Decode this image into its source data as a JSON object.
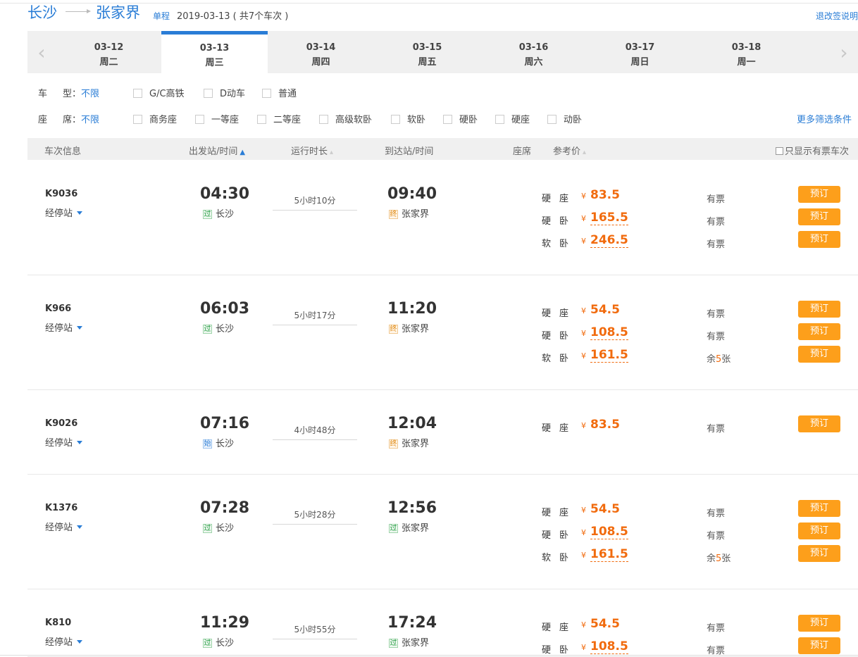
{
  "header": {
    "from_city": "长沙",
    "to_city": "张家界",
    "trip_type": "单程",
    "date_summary": "2019-03-13 ( 共7个车次 )",
    "refund_link": "退改签说明"
  },
  "date_bar": {
    "prev_icon": "chevron-left-icon",
    "next_icon": "chevron-right-icon",
    "dates": [
      {
        "date": "03-12",
        "weekday": "周二"
      },
      {
        "date": "03-13",
        "weekday": "周三"
      },
      {
        "date": "03-14",
        "weekday": "周四"
      },
      {
        "date": "03-15",
        "weekday": "周五"
      },
      {
        "date": "03-16",
        "weekday": "周六"
      },
      {
        "date": "03-17",
        "weekday": "周日"
      },
      {
        "date": "03-18",
        "weekday": "周一"
      }
    ],
    "active_index": 1
  },
  "filters": {
    "train_type": {
      "label_a": "车",
      "label_b": "型：",
      "all": "不限",
      "options": [
        "G/C高铁",
        "D动车",
        "普通"
      ]
    },
    "seat": {
      "label_a": "座",
      "label_b": "席：",
      "all": "不限",
      "options": [
        "商务座",
        "一等座",
        "二等座",
        "高级软卧",
        "软卧",
        "硬卧",
        "硬座",
        "动卧"
      ]
    },
    "more": "更多筛选条件"
  },
  "table_header": {
    "train_info": "车次信息",
    "depart": "出发站/时间",
    "duration": "运行时长",
    "arrive": "到达站/时间",
    "seat": "座席",
    "price": "参考价",
    "only_available": "只显示有票车次"
  },
  "stops_label": "经停站",
  "book_label": "预订",
  "yen": "¥",
  "trains": [
    {
      "no": "K9036",
      "depart_time": "04:30",
      "depart_tag": "过",
      "depart_station": "长沙",
      "duration": "5小时10分",
      "arrive_time": "09:40",
      "arrive_tag": "终",
      "arrive_station": "张家界",
      "seats": [
        {
          "name": "硬座",
          "price": "83.5",
          "avail": "有票"
        },
        {
          "name": "硬卧",
          "price": "165.5",
          "avail": "有票"
        },
        {
          "name": "软卧",
          "price": "246.5",
          "avail": "有票"
        }
      ]
    },
    {
      "no": "K966",
      "depart_time": "06:03",
      "depart_tag": "过",
      "depart_station": "长沙",
      "duration": "5小时17分",
      "arrive_time": "11:20",
      "arrive_tag": "终",
      "arrive_station": "张家界",
      "seats": [
        {
          "name": "硬座",
          "price": "54.5",
          "avail": "有票"
        },
        {
          "name": "硬卧",
          "price": "108.5",
          "avail": "有票"
        },
        {
          "name": "软卧",
          "price": "161.5",
          "avail_pre": "余",
          "avail_num": "5",
          "avail_post": "张"
        }
      ]
    },
    {
      "no": "K9026",
      "depart_time": "07:16",
      "depart_tag": "始",
      "depart_station": "长沙",
      "duration": "4小时48分",
      "arrive_time": "12:04",
      "arrive_tag": "终",
      "arrive_station": "张家界",
      "seats": [
        {
          "name": "硬座",
          "price": "83.5",
          "avail": "有票"
        }
      ]
    },
    {
      "no": "K1376",
      "depart_time": "07:28",
      "depart_tag": "过",
      "depart_station": "长沙",
      "duration": "5小时28分",
      "arrive_time": "12:56",
      "arrive_tag": "过",
      "arrive_station": "张家界",
      "seats": [
        {
          "name": "硬座",
          "price": "54.5",
          "avail": "有票"
        },
        {
          "name": "硬卧",
          "price": "108.5",
          "avail": "有票"
        },
        {
          "name": "软卧",
          "price": "161.5",
          "avail_pre": "余",
          "avail_num": "5",
          "avail_post": "张"
        }
      ]
    },
    {
      "no": "K810",
      "depart_time": "11:29",
      "depart_tag": "过",
      "depart_station": "长沙",
      "duration": "5小时55分",
      "arrive_time": "17:24",
      "arrive_tag": "过",
      "arrive_station": "张家界",
      "seats": [
        {
          "name": "硬座",
          "price": "54.5",
          "avail": "有票"
        },
        {
          "name": "硬卧",
          "price": "108.5",
          "avail": "有票"
        }
      ]
    }
  ]
}
